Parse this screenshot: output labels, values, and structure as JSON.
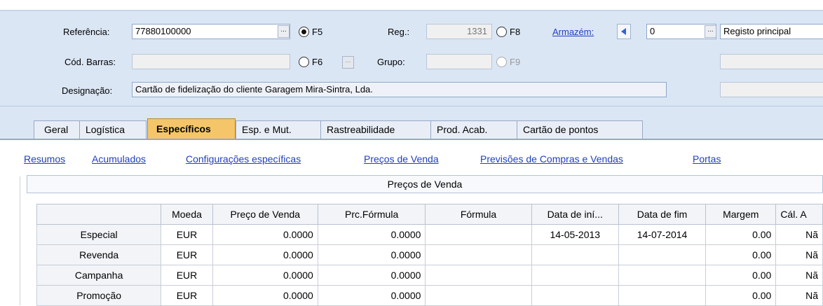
{
  "header": {
    "referencia_label": "Referência:",
    "referencia_value": "77880100000",
    "f5": "F5",
    "reg_label": "Reg.:",
    "reg_value": "1331",
    "f8": "F8",
    "armazem_link": "Armazém:",
    "armazem_value": "0",
    "armazem_desc": "Registo principal",
    "cod_barras_label": "Cód. Barras:",
    "cod_barras_value": "",
    "f6": "F6",
    "grupo_label": "Grupo:",
    "grupo_value": "",
    "f9": "F9",
    "designacao_label": "Designação:",
    "designacao_value": "Cartão de fidelização do cliente Garagem Mira-Sintra, Lda.",
    "dots": "...",
    "accent_color": "#2f63d6"
  },
  "tabs": [
    {
      "label": "Geral"
    },
    {
      "label": "Logística"
    },
    {
      "label": "Específicos"
    },
    {
      "label": "Esp. e Mut."
    },
    {
      "label": "Rastreabilidade"
    },
    {
      "label": "Prod. Acab."
    },
    {
      "label": "Cartão de pontos"
    }
  ],
  "links": [
    {
      "label": "Resumos"
    },
    {
      "label": "Acumulados"
    },
    {
      "label": "Configurações específicas"
    },
    {
      "label": "Preços de Venda"
    },
    {
      "label": "Previsões de Compras e Vendas"
    },
    {
      "label": "Portas"
    }
  ],
  "section_title": "Preços de Venda",
  "grid": {
    "columns": [
      "",
      "Moeda",
      "Preço de Venda",
      "Prc.Fórmula",
      "Fórmula",
      "Data de iní...",
      "Data de fim",
      "Margem",
      "Cál. A"
    ],
    "rows": [
      {
        "name": "Especial",
        "moeda": "EUR",
        "preco": "0.0000",
        "prc_formula": "0.0000",
        "formula": "",
        "data_ini": "14-05-2013",
        "data_fim": "14-07-2014",
        "margem": "0.00",
        "calc": "Nã"
      },
      {
        "name": "Revenda",
        "moeda": "EUR",
        "preco": "0.0000",
        "prc_formula": "0.0000",
        "formula": "",
        "data_ini": "",
        "data_fim": "",
        "margem": "0.00",
        "calc": "Nã"
      },
      {
        "name": "Campanha",
        "moeda": "EUR",
        "preco": "0.0000",
        "prc_formula": "0.0000",
        "formula": "",
        "data_ini": "",
        "data_fim": "",
        "margem": "0.00",
        "calc": "Nã"
      },
      {
        "name": "Promoção",
        "moeda": "EUR",
        "preco": "0.0000",
        "prc_formula": "0.0000",
        "formula": "",
        "data_ini": "",
        "data_fim": "",
        "margem": "0.00",
        "calc": "Nã"
      }
    ]
  }
}
